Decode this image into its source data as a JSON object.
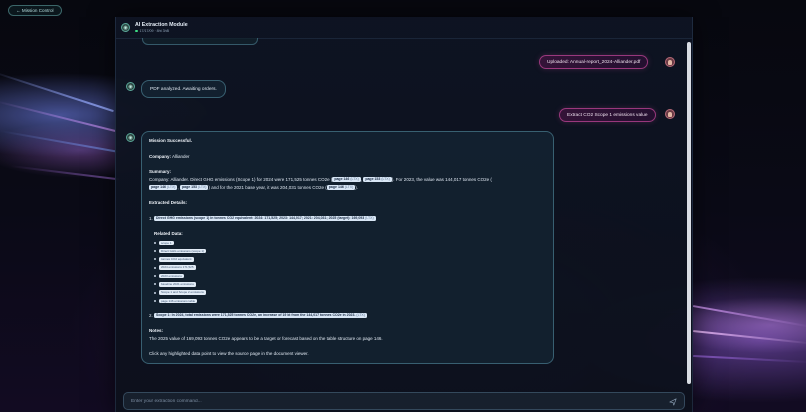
{
  "nav": {
    "back_label": "← Mission Control"
  },
  "header": {
    "title": "AI Extraction Module",
    "status": "17/17/09 · 8ht 3hB",
    "avatar_icon": "robot-icon"
  },
  "messages": {
    "uploaded": "Uploaded: Annual-report_2024-Alliander.pdf",
    "analyzed": "PDF analyzed. Awaiting orders.",
    "command": "Extract CO2 Scope 1 emissions value"
  },
  "result": {
    "heading": "Mission Successful.",
    "company_label": "Company:",
    "company_value": "Alliander",
    "summary_label": "Summary:",
    "summary_line1": "Company: Alliander. Direct GHG emissions (Scope 1) for 2024 were 171,525 tonnes CO2e (",
    "summary_mid1": ",",
    "summary_mid2": "). For 2023, the value was 144,017 tonnes CO2e (",
    "summary_line2_mid1": ",",
    "summary_line2_mid2": ") and for the 2021 base year, it was 204,031 tonnes CO2e (",
    "summary_line2_end": ").",
    "tags": {
      "p146": "page 146",
      "p153": "page 153",
      "ltx": "(LTX)"
    },
    "details_label": "Extracted Details:",
    "detail1_num": "1.",
    "detail1_tag": "Direct GHG emissions (scope 1) in tonnes CO2 equivalent: 2024: 171,525; 2023: 144,017; 2021: 204,031; 2025 (target): 169,093",
    "related_label": "Related Data:",
    "related": [
      "scope 1",
      "Direct GHG emissions (scope 1)",
      "tonnes CO2 equivalent",
      "2024 emissions 171,525",
      "2023 emissions",
      "baseline 2021 emissions",
      "Scope 1 and Scope 2 emissions",
      "page 146 emissions table"
    ],
    "detail2_num": "2.",
    "detail2_tag": "Scope 1: In 2024, total emissions were 171,525 tonnes CO2e, an increase of 19 kt from the 144,017 tonnes CO2e in 2023.",
    "notes_label": "Notes:",
    "notes_text": "The 2025 value of 169,093 tonnes CO2e appears to be a target or forecast based on the table structure on page 146.",
    "footer_text": "Click any highlighted data point to view the source page in the document viewer."
  },
  "input": {
    "placeholder": "Enter your extraction command..."
  },
  "colors": {
    "accent_teal": "#5aa597",
    "user_border": "#be4696",
    "tag_bg": "#d8e6f5"
  }
}
